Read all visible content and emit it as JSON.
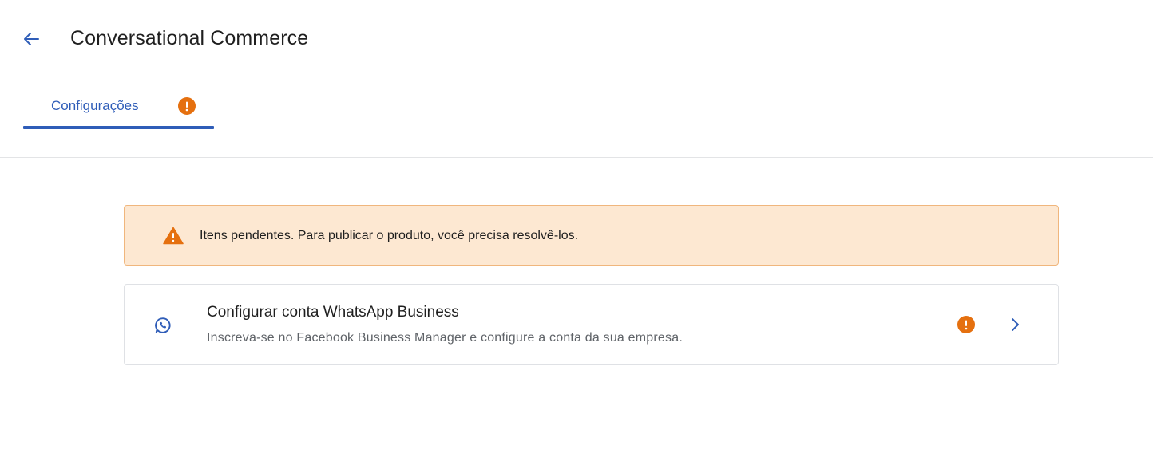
{
  "header": {
    "back_icon": "arrow-left-icon",
    "title": "Conversational Commerce"
  },
  "tabs": [
    {
      "label": "Configurações",
      "active": true,
      "badge_icon": "exclamation-circle-icon"
    }
  ],
  "alert": {
    "icon": "warning-triangle-icon",
    "text": "Itens pendentes. Para publicar o produto, você precisa resolvê-los."
  },
  "setup_item": {
    "icon": "whatsapp-icon",
    "title": "Configurar conta WhatsApp Business",
    "subtitle": "Inscreva-se no Facebook Business Manager e configure a conta da sua empresa.",
    "status_icon": "exclamation-circle-icon",
    "action_icon": "chevron-right-icon"
  },
  "colors": {
    "accent": "#2f5db8",
    "warning": "#e5700f",
    "alert_background": "#fde8d2",
    "alert_border": "#f0b67d"
  }
}
